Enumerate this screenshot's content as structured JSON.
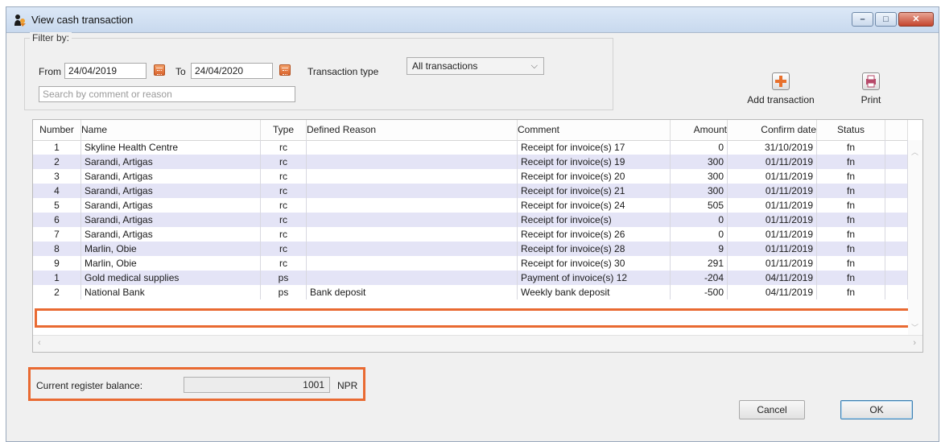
{
  "window": {
    "title": "View cash transaction",
    "controls": [
      "minimize",
      "maximize",
      "close"
    ]
  },
  "filter": {
    "legend": "Filter by:",
    "from_label": "From",
    "from_value": "24/04/2019",
    "to_label": "To",
    "to_value": "24/04/2020",
    "type_label": "Transaction type",
    "type_value": "All transactions",
    "search_placeholder": "Search by comment or reason"
  },
  "toolbar": {
    "add_label": "Add transaction",
    "print_label": "Print"
  },
  "table": {
    "columns": [
      "Number",
      "Name",
      "Type",
      "Defined Reason",
      "Comment",
      "Amount",
      "Confirm date",
      "Status"
    ],
    "rows": [
      {
        "number": "1",
        "name": "Skyline Health Centre",
        "type": "rc",
        "reason": "",
        "comment": "Receipt for invoice(s) 17",
        "amount": "0",
        "date": "31/10/2019",
        "status": "fn"
      },
      {
        "number": "2",
        "name": "Sarandi, Artigas",
        "type": "rc",
        "reason": "",
        "comment": "Receipt for invoice(s) 19",
        "amount": "300",
        "date": "01/11/2019",
        "status": "fn"
      },
      {
        "number": "3",
        "name": "Sarandi, Artigas",
        "type": "rc",
        "reason": "",
        "comment": "Receipt for invoice(s) 20",
        "amount": "300",
        "date": "01/11/2019",
        "status": "fn"
      },
      {
        "number": "4",
        "name": "Sarandi, Artigas",
        "type": "rc",
        "reason": "",
        "comment": "Receipt for invoice(s) 21",
        "amount": "300",
        "date": "01/11/2019",
        "status": "fn"
      },
      {
        "number": "5",
        "name": "Sarandi, Artigas",
        "type": "rc",
        "reason": "",
        "comment": "Receipt for invoice(s) 24",
        "amount": "505",
        "date": "01/11/2019",
        "status": "fn"
      },
      {
        "number": "6",
        "name": "Sarandi, Artigas",
        "type": "rc",
        "reason": "",
        "comment": "Receipt for invoice(s)",
        "amount": "0",
        "date": "01/11/2019",
        "status": "fn"
      },
      {
        "number": "7",
        "name": "Sarandi, Artigas",
        "type": "rc",
        "reason": "",
        "comment": "Receipt for invoice(s) 26",
        "amount": "0",
        "date": "01/11/2019",
        "status": "fn"
      },
      {
        "number": "8",
        "name": "Marlin, Obie",
        "type": "rc",
        "reason": "",
        "comment": "Receipt for invoice(s) 28",
        "amount": "9",
        "date": "01/11/2019",
        "status": "fn"
      },
      {
        "number": "9",
        "name": "Marlin, Obie",
        "type": "rc",
        "reason": "",
        "comment": "Receipt for invoice(s) 30",
        "amount": "291",
        "date": "01/11/2019",
        "status": "fn"
      },
      {
        "number": "1",
        "name": "Gold medical supplies",
        "type": "ps",
        "reason": "",
        "comment": "Payment of invoice(s) 12",
        "amount": "-204",
        "date": "04/11/2019",
        "status": "fn"
      },
      {
        "number": "2",
        "name": "National Bank",
        "type": "ps",
        "reason": "Bank deposit",
        "comment": "Weekly bank deposit",
        "amount": "-500",
        "date": "04/11/2019",
        "status": "fn"
      }
    ]
  },
  "balance": {
    "label": "Current register balance:",
    "value": "1001",
    "currency": "NPR"
  },
  "buttons": {
    "cancel": "Cancel",
    "ok": "OK"
  },
  "colors": {
    "highlight": "#e96a32",
    "alt_row": "#e4e4f6",
    "titlebar": "#c8d9ee"
  }
}
